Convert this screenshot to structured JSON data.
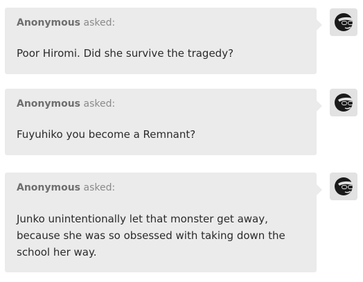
{
  "asks": [
    {
      "asker": "Anonymous",
      "suffix": "asked:",
      "question": "Poor Hiromi. Did she survive the tragedy?",
      "avatar_icon": "sunglasses-face-icon"
    },
    {
      "asker": "Anonymous",
      "suffix": "asked:",
      "question": "Fuyuhiko you become a Remnant?",
      "avatar_icon": "sunglasses-face-icon"
    },
    {
      "asker": "Anonymous",
      "suffix": "asked:",
      "question": "Junko unintentionally let that monster get away, because she was so obsessed with taking down the school her way.",
      "avatar_icon": "sunglasses-face-icon"
    }
  ],
  "colors": {
    "bubble": "#ebebeb",
    "avatar_bg": "#e2e2e2",
    "icon": "#1a1a1a"
  }
}
